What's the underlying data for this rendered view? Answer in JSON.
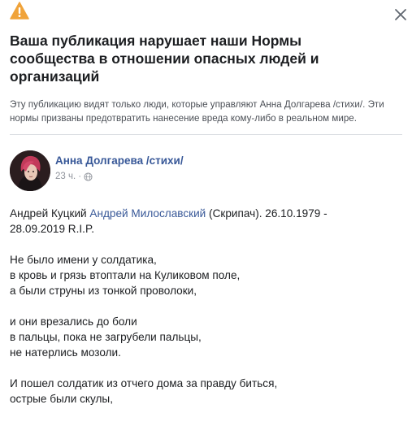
{
  "dialog": {
    "title": "Ваша публикация нарушает наши Нормы сообщества в отношении опасных людей и организаций",
    "subtitle": "Эту публикацию видят только люди, которые управляют Анна Долгарева /стихи/. Эти нормы призваны предотвратить нанесение вреда кому-либо в реальном мире.",
    "close_label": "✕"
  },
  "post": {
    "author": "Анна Долгарева /стихи/",
    "time": "23 ч.",
    "intro": {
      "prefix": "Андрей Куцкий ",
      "tagged": "Андрей Милославский",
      "middle": " (Скрипач). 26.10.1979 -",
      "line2": "28.09.2019 R.I.P."
    },
    "stanza1": [
      "Не было имени у солдатика,",
      "в кровь и грязь втоптали на Куликовом поле,",
      "а были струны из тонкой проволоки,"
    ],
    "stanza2": [
      "и они врезались до боли",
      "в пальцы, пока не загрубели пальцы,",
      "не натерлись мозоли."
    ],
    "stanza3": [
      "И пошел солдатик из отчего дома за правду биться,",
      "острые были скулы,"
    ]
  },
  "colors": {
    "warning": "#f0a33a",
    "link": "#385898",
    "muted": "#90949c"
  },
  "icons": {
    "warning": "warning-triangle-icon",
    "close": "close-icon",
    "audience": "globe-icon"
  }
}
